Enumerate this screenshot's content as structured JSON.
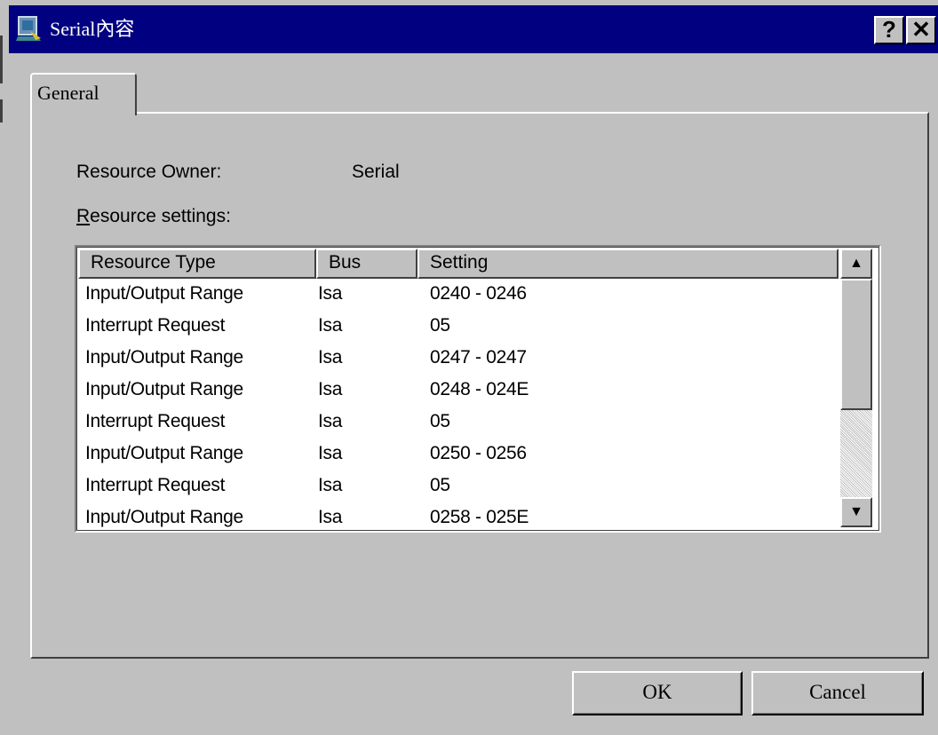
{
  "window": {
    "title": "Serial內容",
    "help_label": "?",
    "close_label": "✕"
  },
  "tabs": [
    {
      "label": "General",
      "active": true
    }
  ],
  "general": {
    "resource_owner_label": "Resource Owner:",
    "resource_owner_value": "Serial",
    "resource_settings_label_first": "R",
    "resource_settings_label_rest": "esource settings:"
  },
  "table": {
    "columns": [
      "Resource Type",
      "Bus",
      "Setting"
    ],
    "rows": [
      [
        "Input/Output Range",
        "Isa",
        "0240 - 0246"
      ],
      [
        "Interrupt Request",
        "Isa",
        "05"
      ],
      [
        "Input/Output Range",
        "Isa",
        "0247 - 0247"
      ],
      [
        "Input/Output Range",
        "Isa",
        "0248 - 024E"
      ],
      [
        "Interrupt Request",
        "Isa",
        "05"
      ],
      [
        "Input/Output Range",
        "Isa",
        "0250 - 0256"
      ],
      [
        "Interrupt Request",
        "Isa",
        "05"
      ],
      [
        "Input/Output Range",
        "Isa",
        "0258 - 025E"
      ]
    ],
    "scroll_up_label": "▲",
    "scroll_down_label": "▼"
  },
  "buttons": {
    "ok_label": "OK",
    "cancel_label": "Cancel"
  },
  "colors": {
    "titlebar": "#000080",
    "face": "#c0c0c0",
    "list_background": "#ffffff"
  }
}
